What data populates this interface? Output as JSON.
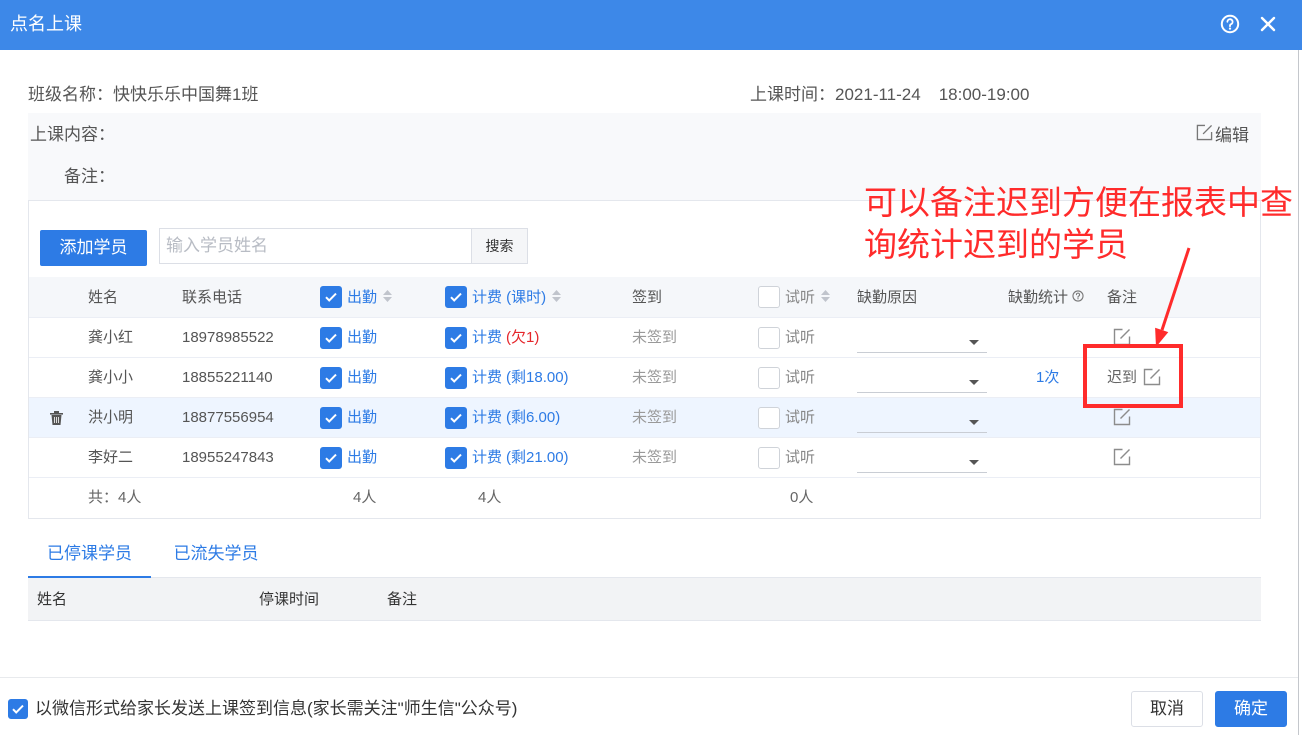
{
  "colors": {
    "header_bar": "#3d88e8",
    "primary": "#2d7be5",
    "owed_red": "#e5262b",
    "annotation_red": "#ff2b2b"
  },
  "dialog": {
    "title": "点名上课",
    "help_icon": "question-circle-icon",
    "close_icon": "close-icon"
  },
  "lesson": {
    "class_label": "班级名称：",
    "class_name": "快快乐乐中国舞1班",
    "time_label": "上课时间：",
    "date": "2021-11-24",
    "time_range": "18:00-19:00",
    "content_label": "上课内容：",
    "edit_label": "编辑",
    "note_label": "备注："
  },
  "annotation": {
    "lines": [
      "可以备注迟到方便在报表中查",
      "询统计迟到的学员"
    ]
  },
  "toolbar": {
    "add_student": "添加学员",
    "search_placeholder": "输入学员姓名",
    "search_button": "搜索"
  },
  "roster": {
    "headers": {
      "name": "姓名",
      "phone": "联系电话",
      "attend": "出勤",
      "attend_checked": true,
      "billing": "计费 (课时)",
      "billing_checked": true,
      "checkin": "签到",
      "trial": "试听",
      "trial_checked": false,
      "absence_reason": "缺勤原因",
      "absence_count": "缺勤统计",
      "note": "备注"
    },
    "rows": [
      {
        "name": "龚小红",
        "phone": "18978985522",
        "attend": true,
        "attend_label": "出勤",
        "billing": true,
        "billing_label": "计费",
        "billing_detail": "(欠1)",
        "billing_owed": true,
        "checkin": "未签到",
        "trial": false,
        "trial_label": "试听",
        "absence_reason": "",
        "absence_count": "",
        "note": "",
        "hovered": false
      },
      {
        "name": "龚小小",
        "phone": "18855221140",
        "attend": true,
        "attend_label": "出勤",
        "billing": true,
        "billing_label": "计费",
        "billing_detail": "(剩18.00)",
        "billing_owed": false,
        "checkin": "未签到",
        "trial": false,
        "trial_label": "试听",
        "absence_reason": "",
        "absence_count": "1次",
        "note": "迟到",
        "hovered": false
      },
      {
        "name": "洪小明",
        "phone": "18877556954",
        "attend": true,
        "attend_label": "出勤",
        "billing": true,
        "billing_label": "计费",
        "billing_detail": "(剩6.00)",
        "billing_owed": false,
        "checkin": "未签到",
        "trial": false,
        "trial_label": "试听",
        "absence_reason": "",
        "absence_count": "",
        "note": "",
        "hovered": true
      },
      {
        "name": "李好二",
        "phone": "18955247843",
        "attend": true,
        "attend_label": "出勤",
        "billing": true,
        "billing_label": "计费",
        "billing_detail": "(剩21.00)",
        "billing_owed": false,
        "checkin": "未签到",
        "trial": false,
        "trial_label": "试听",
        "absence_reason": "",
        "absence_count": "",
        "note": "",
        "hovered": false
      }
    ],
    "summary": {
      "total": "共：4人",
      "attend": "4人",
      "billing": "4人",
      "trial": "0人"
    }
  },
  "tabs": [
    {
      "label": "已停课学员",
      "active": true
    },
    {
      "label": "已流失学员",
      "active": false
    }
  ],
  "suspended_table": {
    "headers": {
      "name": "姓名",
      "suspend_time": "停课时间",
      "note": "备注"
    }
  },
  "footer": {
    "notify_checked": true,
    "notify_label": "以微信形式给家长发送上课签到信息(家长需关注\"师生信\"公众号)",
    "cancel": "取消",
    "confirm": "确定"
  }
}
